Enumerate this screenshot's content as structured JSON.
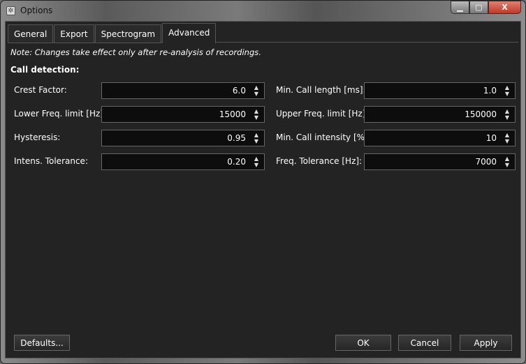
{
  "window": {
    "title": "Options",
    "icon": "gear-icon",
    "controls": [
      "minimize",
      "maximize",
      "close"
    ],
    "close_glyph": "X"
  },
  "tabs": [
    {
      "label": "General"
    },
    {
      "label": "Export"
    },
    {
      "label": "Spectrogram"
    },
    {
      "label": "Advanced",
      "active": true
    }
  ],
  "note": "Note: Changes take effect only after re-analysis of recordings.",
  "section": "Call detection:",
  "left_fields": [
    {
      "label": "Crest Factor:",
      "value": "6.0"
    },
    {
      "label": "Lower Freq. limit [Hz]:",
      "value": "15000"
    },
    {
      "label": "Hysteresis:",
      "value": "0.95"
    },
    {
      "label": "Intens. Tolerance:",
      "value": "0.20"
    }
  ],
  "right_fields": [
    {
      "label": "Min. Call length [ms]:",
      "value": "1.0"
    },
    {
      "label": "Upper Freq. limit [Hz]:",
      "value": "150000"
    },
    {
      "label": "Min. Call intensity [%]:",
      "value": "10"
    },
    {
      "label": "Freq. Tolerance [Hz]:",
      "value": "7000"
    }
  ],
  "buttons": {
    "defaults": "Defaults...",
    "ok": "OK",
    "cancel": "Cancel",
    "apply": "Apply"
  }
}
